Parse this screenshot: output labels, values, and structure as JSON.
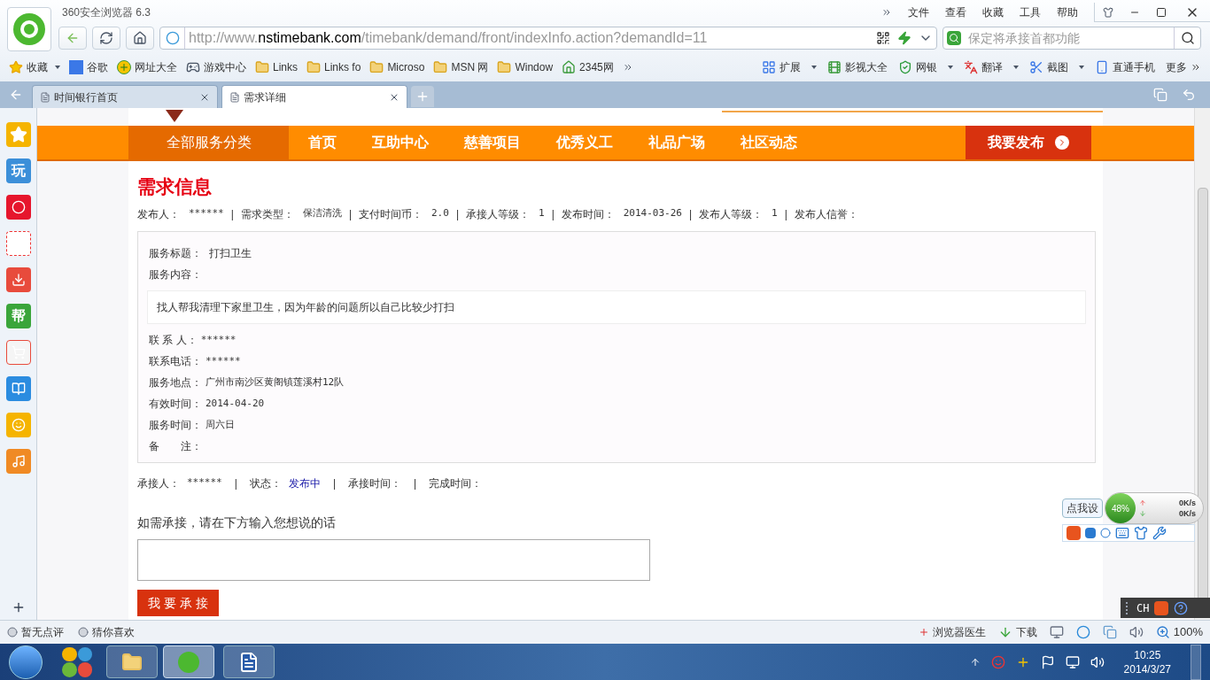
{
  "browser": {
    "title": "360安全浏览器 6.3",
    "menu": [
      "文件",
      "查看",
      "收藏",
      "工具",
      "帮助"
    ],
    "address": {
      "scheme": "http://www.",
      "host": "nstimebank.com",
      "path": "/timebank/demand/front/indexInfo.action?demandId=11"
    },
    "search": {
      "placeholder": "保定将承接首都功能"
    },
    "bookmarks": [
      {
        "label": "收藏",
        "kind": "star",
        "dropdown": true
      },
      {
        "label": "谷歌",
        "kind": "g",
        "dropdown": false
      },
      {
        "label": "网址大全",
        "kind": "plus",
        "dropdown": false
      },
      {
        "label": "游戏中心",
        "kind": "game",
        "dropdown": false
      },
      {
        "label": "Links",
        "kind": "folder",
        "dropdown": false
      },
      {
        "label": "Links fo",
        "kind": "folder",
        "dropdown": false
      },
      {
        "label": "Microso",
        "kind": "folder",
        "dropdown": false
      },
      {
        "label": "MSN 网",
        "kind": "folder",
        "dropdown": false
      },
      {
        "label": "Window",
        "kind": "folder",
        "dropdown": false
      },
      {
        "label": "2345网",
        "kind": "house",
        "dropdown": false
      }
    ],
    "tools": [
      {
        "label": "扩展",
        "kind": "grid",
        "dropdown": true
      },
      {
        "label": "影视大全",
        "kind": "film",
        "dropdown": false
      },
      {
        "label": "网银",
        "kind": "shield",
        "dropdown": true
      },
      {
        "label": "翻译",
        "kind": "translate",
        "dropdown": true
      },
      {
        "label": "截图",
        "kind": "scissors",
        "dropdown": true
      },
      {
        "label": "直通手机",
        "kind": "phone",
        "dropdown": false
      },
      {
        "label": "更多",
        "kind": "more",
        "dropdown": false
      }
    ],
    "tabs": [
      {
        "label": "时间银行首页",
        "selected": false
      },
      {
        "label": "需求详细",
        "selected": true
      }
    ]
  },
  "sidebar": [
    {
      "kind": "star"
    },
    {
      "kind": "text",
      "label": "玩",
      "color": "#3b8fd9"
    },
    {
      "kind": "weibo"
    },
    {
      "kind": "at"
    },
    {
      "kind": "download"
    },
    {
      "kind": "text",
      "label": "帮",
      "color": "#3aa53a"
    },
    {
      "kind": "cart"
    },
    {
      "kind": "book"
    },
    {
      "kind": "face"
    },
    {
      "kind": "music"
    }
  ],
  "page": {
    "nav": {
      "category": "全部服务分类",
      "items": [
        "首页",
        "互助中心",
        "慈善项目",
        "优秀义工",
        "礼品广场",
        "社区动态"
      ],
      "publish": "我要发布"
    },
    "title": "需求信息",
    "separator": "|",
    "meta": [
      {
        "label": "发布人：",
        "value": "******"
      },
      {
        "label": "需求类型：",
        "value": "保洁清洗"
      },
      {
        "label": "支付时间币：",
        "value": "2.0"
      },
      {
        "label": "承接人等级：",
        "value": "1"
      },
      {
        "label": "发布时间：",
        "value": "2014-03-26"
      },
      {
        "label": "发布人等级：",
        "value": "1"
      },
      {
        "label": "发布人信誉："
      }
    ],
    "detail": {
      "head": [
        {
          "label": "服务标题：",
          "value": "打扫卫生"
        },
        {
          "label": "服务内容："
        }
      ],
      "content": "找人帮我清理下家里卫生，因为年龄的问题所以自己比较少打扫",
      "fields": [
        {
          "label": "联 系 人：",
          "value": "******"
        },
        {
          "label": "联系电话：",
          "value": "******"
        },
        {
          "label": "服务地点：",
          "value": "广州市南沙区黄阁镇莲溪村12队"
        },
        {
          "label": "有效时间：",
          "value": "2014-04-20"
        },
        {
          "label": "服务时间：",
          "value": "周六日"
        },
        {
          "label": "备　　注："
        }
      ]
    },
    "status_line": [
      {
        "label": "承接人：",
        "value": "******",
        "kind": "plain"
      },
      {
        "label": "状态：",
        "value": "发布中",
        "kind": "status"
      },
      {
        "label": "承接时间：",
        "kind": "plain"
      },
      {
        "label": "完成时间：",
        "kind": "plain"
      }
    ],
    "prompt": "如需承接，请在下方输入您想说的话",
    "accept_button": "我 要 承 接"
  },
  "ime_widget": {
    "tooltip": "点我设",
    "percent": "48%",
    "up": "0K/s",
    "down": "0K/s"
  },
  "ime_bar": {
    "lang": "CH"
  },
  "status_bar": {
    "left": [
      "暂无点评",
      "猜你喜欢"
    ],
    "doctor": "浏览器医生",
    "download": "下载",
    "zoom": "100%"
  },
  "taskbar": {
    "time": "10:25",
    "date": "2014/3/27"
  }
}
